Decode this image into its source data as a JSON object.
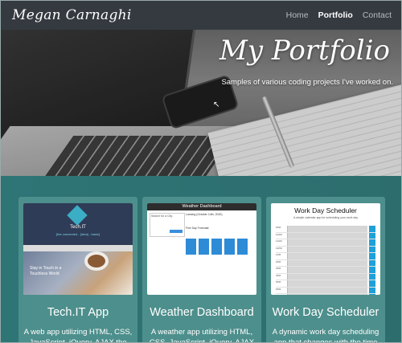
{
  "navbar": {
    "brand": "Megan Carnaghi",
    "links": [
      {
        "label": "Home",
        "active": false
      },
      {
        "label": "Portfolio",
        "active": true
      },
      {
        "label": "Contact",
        "active": false
      }
    ]
  },
  "hero": {
    "title": "My Portfolio",
    "subtitle": "Samples of various coding projects I've worked on."
  },
  "cards": [
    {
      "title": "Tech.IT App",
      "description": "A web app utilizing HTML, CSS, JavaScript, jQuery, AJAX the",
      "thumb": {
        "app_name": "Tech.IT",
        "tagline": "[the connected - {idea} - basic]",
        "overlay_text": "Stay in Touch in a Touchless World"
      }
    },
    {
      "title": "Weather Dashboard",
      "description": "A weather app utilizing HTML, CSS, JavaScript, jQuery, AJAX",
      "thumb": {
        "header": "Weather Dashboard",
        "search_label": "Search for a City:",
        "city_line": "Lansing (October 14th, 2020)",
        "forecast_label": "Five Day Forecast:"
      }
    },
    {
      "title": "Work Day Scheduler",
      "description": "A dynamic work day scheduling app that changes with the time",
      "thumb": {
        "header": "Work Day Scheduler",
        "subheader": "A simple calendar app for scheduling your work day",
        "hours": [
          "9AM",
          "10AM",
          "11AM",
          "12PM",
          "1PM",
          "2PM",
          "3PM",
          "4PM",
          "5PM",
          "6PM",
          "7PM"
        ]
      }
    }
  ],
  "colors": {
    "navbar": "#343a40",
    "card_bg": "#4d8f8c",
    "section_bg": "#2e7273",
    "accent_blue": "#1ea0d8"
  }
}
